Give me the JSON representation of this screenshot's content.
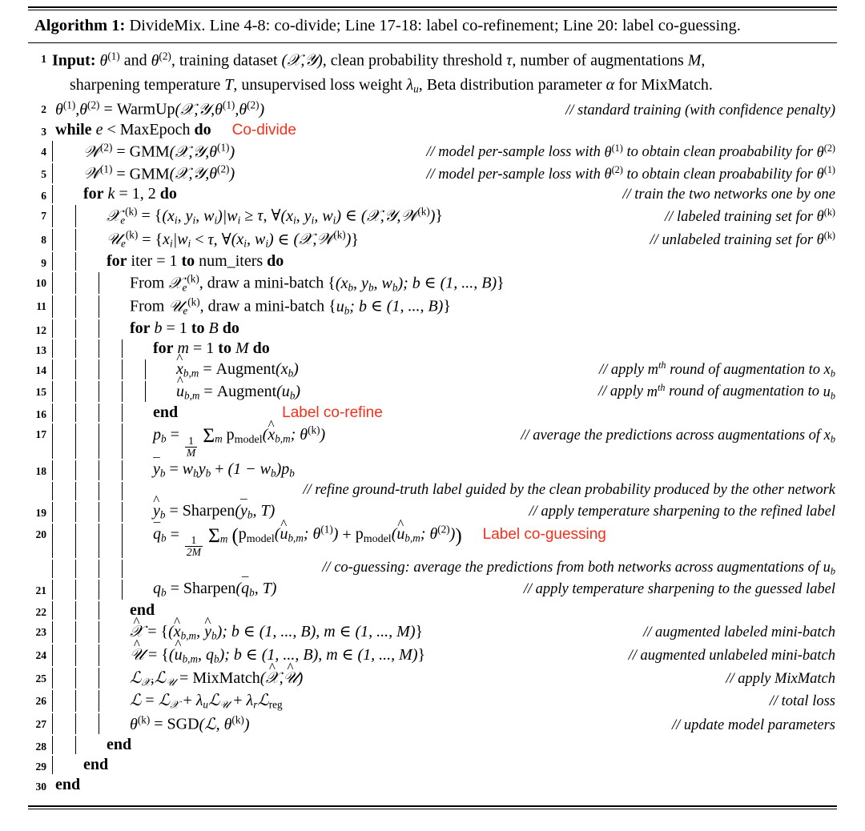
{
  "caption": {
    "label": "Algorithm 1:",
    "text": "DivideMix. Line 4-8: co-divide; Line 17-18: label co-refinement; Line 20: label co-guessing."
  },
  "annotations": {
    "color": "#f4301a",
    "co_divide": "Co-divide",
    "label_co_refine": "Label co-refine",
    "label_co_guessing": "Label co-guessing"
  },
  "lines": {
    "n1": "1",
    "n2": "2",
    "n3": "3",
    "n4": "4",
    "n5": "5",
    "n6": "6",
    "n7": "7",
    "n8": "8",
    "n9": "9",
    "n10": "10",
    "n11": "11",
    "n12": "12",
    "n13": "13",
    "n14": "14",
    "n15": "15",
    "n16": "16",
    "n17": "17",
    "n18": "18",
    "n19": "19",
    "n20": "20",
    "n21": "21",
    "n22": "22",
    "n23": "23",
    "n24": "24",
    "n25": "25",
    "n26": "26",
    "n27": "27",
    "n28": "28",
    "n29": "29",
    "n30": "30"
  },
  "keywords": {
    "input": "Input:",
    "while": "while",
    "do": "do",
    "for": "for",
    "to": "to",
    "end": "end"
  },
  "code": {
    "l1_part1": "Input:",
    "l1_text": "θ(1) and θ(2), training dataset (X, Y), clean probability threshold τ, number of augmentations M, sharpening temperature T, unsupervised loss weight λu, Beta distribution parameter α for MixMatch.",
    "l2": "θ(1), θ(2) = WarmUp(X, Y, θ(1), θ(2))",
    "l3": "while e < MaxEpoch do",
    "l4": "W(2) = GMM(X, Y, θ(1))",
    "l5": "W(1) = GMM(X, Y, θ(2))",
    "l6": "for k = 1, 2 do",
    "l7": "Xe(k) = {(xi, yi, wi)|wi ≥ τ, ∀(xi, yi, wi) ∈ (X, Y, W(k))}",
    "l8": "Ue(k) = {xi|wi < τ, ∀(xi, wi) ∈ (X, W(k))}",
    "l9": "for iter = 1 to num_iters do",
    "l10": "From Xe(k), draw a mini-batch {(xb, yb, wb); b ∈ (1, ..., B)}",
    "l11": "From Ue(k), draw a mini-batch {ub; b ∈ (1, ..., B)}",
    "l12": "for b = 1 to B do",
    "l13": "for m = 1 to M do",
    "l14": "x̂b,m = Augment(xb)",
    "l15": "ûb,m = Augment(ub)",
    "l16": "end",
    "l17": "pb = 1/M Σm pmodel(x̂b,m; θ(k))",
    "l18": "ȳb = wb yb + (1 − wb)pb",
    "l19": "ŷb = Sharpen(ȳb, T)",
    "l20": "q̄b = 1/2M Σm (pmodel(ûb,m; θ(1)) + pmodel(ûb,m; θ(2)))",
    "l21": "qb = Sharpen(q̄b, T)",
    "l22": "end",
    "l23": "X̂ = {(x̂b,m, ŷb); b ∈ (1, ..., B), m ∈ (1, ..., M)}",
    "l24": "Û = {(ûb,m, qb); b ∈ (1, ..., B), m ∈ (1, ..., M)}",
    "l25": "LX, LU = MixMatch(X̂, Û)",
    "l26": "L = LX + λu LU + λr Lreg",
    "l27": "θ(k) = SGD(L, θ(k))",
    "l28": "end",
    "l29": "end",
    "l30": "end"
  },
  "comments": {
    "c2": "// standard training (with confidence penalty)",
    "c4": "// model per-sample loss with θ(1) to obtain clean proabability for θ(2)",
    "c5": "// model per-sample loss with θ(2) to obtain clean proabability for θ(1)",
    "c6": "// train the two networks one by one",
    "c7": "// labeled training set for θ(k)",
    "c8": "// unlabeled training set for θ(k)",
    "c14": "// apply mth round of augmentation to xb",
    "c15": "// apply mth round of augmentation to ub",
    "c17": "// average the predictions across augmentations of xb",
    "c18": "// refine ground-truth label guided by the clean probability produced by the other network",
    "c19": "// apply temperature sharpening to the refined label",
    "c20": "// co-guessing: average the predictions from both networks across augmentations of ub",
    "c21": "// apply temperature sharpening to the guessed label",
    "c23": "// augmented labeled mini-batch",
    "c24": "// augmented unlabeled mini-batch",
    "c25": "// apply MixMatch",
    "c26": "// total loss",
    "c27": "// update model parameters"
  }
}
